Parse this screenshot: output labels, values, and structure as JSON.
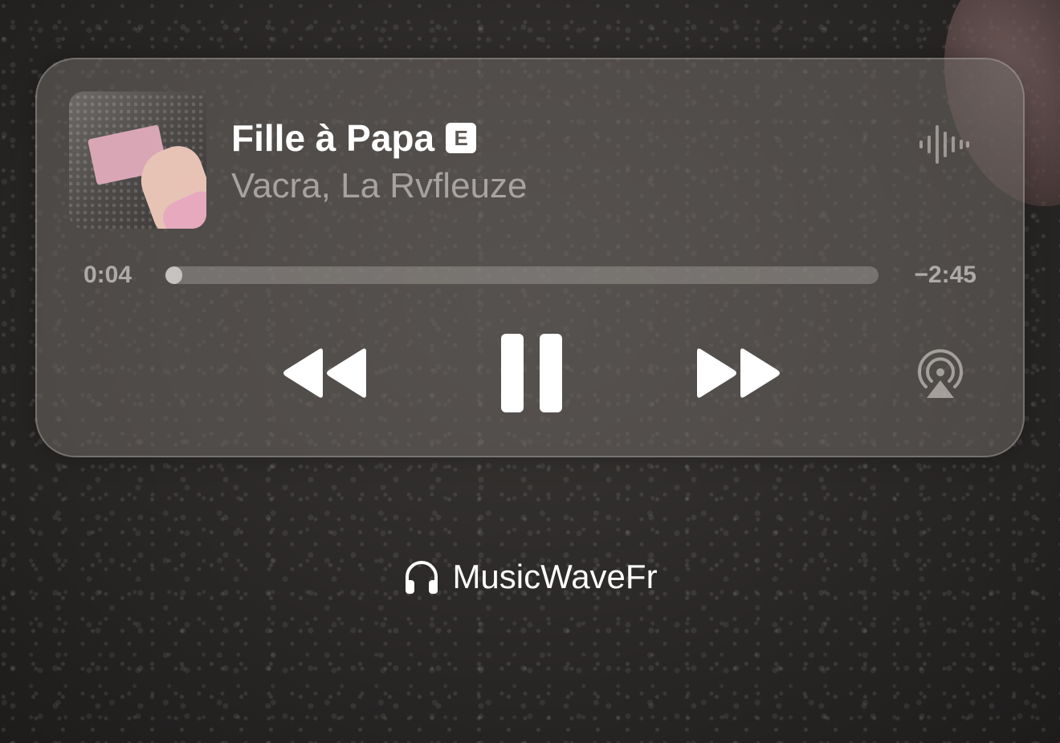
{
  "now_playing": {
    "title": "Fille à Papa",
    "explicit_badge": "E",
    "artist": "Vacra, La Rvfleuze",
    "elapsed": "0:04",
    "remaining": "−2:45",
    "progress_fraction": 0.024,
    "artwork_icon": "album-artwork",
    "wave_icon": "audio-waveform-icon"
  },
  "controls": {
    "rewind_icon": "rewind-icon",
    "pause_icon": "pause-icon",
    "forward_icon": "fast-forward-icon",
    "airplay_icon": "airplay-icon"
  },
  "footer": {
    "icon": "headphones-icon",
    "label": "MusicWaveFr"
  },
  "colors": {
    "text_primary": "#ffffff",
    "text_secondary": "#a8a29e",
    "panel": "#6e6864"
  }
}
